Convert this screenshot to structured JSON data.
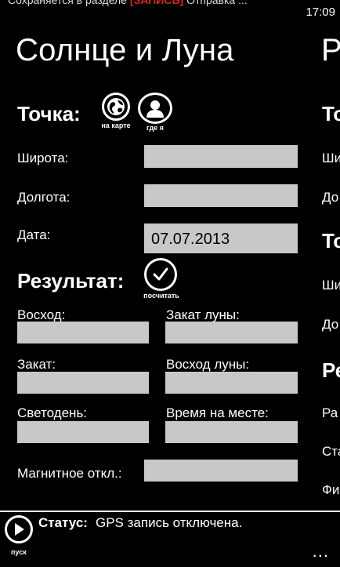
{
  "status_bar": {
    "ticker_pre": "Сохраняется в разделе ",
    "ticker_highlight": "[ЗАПИСЬ]",
    "ticker_post": " Отправка ...",
    "time": "17:09"
  },
  "app": {
    "title": "Солнце и Луна",
    "next_page_title_peek": "Р"
  },
  "point": {
    "heading": "Точка:",
    "map_button_caption": "на карте",
    "whereami_button_caption": "где я",
    "latitude_label": "Широта:",
    "latitude_value": "",
    "longitude_label": "Долгота:",
    "longitude_value": "",
    "date_label": "Дата:",
    "date_value": "07.07.2013"
  },
  "result": {
    "heading": "Результат:",
    "calc_button_caption": "посчитать",
    "sunrise_label": "Восход:",
    "sunrise_value": "",
    "moonset_label": "Закат луны:",
    "moonset_value": "",
    "sunset_label": "Закат:",
    "sunset_value": "",
    "moonrise_label": "Восход луны:",
    "moonrise_value": "",
    "daylight_label": "Светодень:",
    "daylight_value": "",
    "localtime_label": "Время на месте:",
    "localtime_value": "",
    "magnetic_label": "Магнитное откл.:",
    "magnetic_value": ""
  },
  "peek_panel": {
    "items": [
      "То",
      "Ши",
      "До",
      "То",
      "Ши",
      "До",
      "Ре",
      "Ра",
      "Ста",
      "Фи"
    ]
  },
  "bottom": {
    "start_caption": "пуск",
    "status_label": "Статус:",
    "status_text": "GPS запись отключена.",
    "more": "..."
  }
}
